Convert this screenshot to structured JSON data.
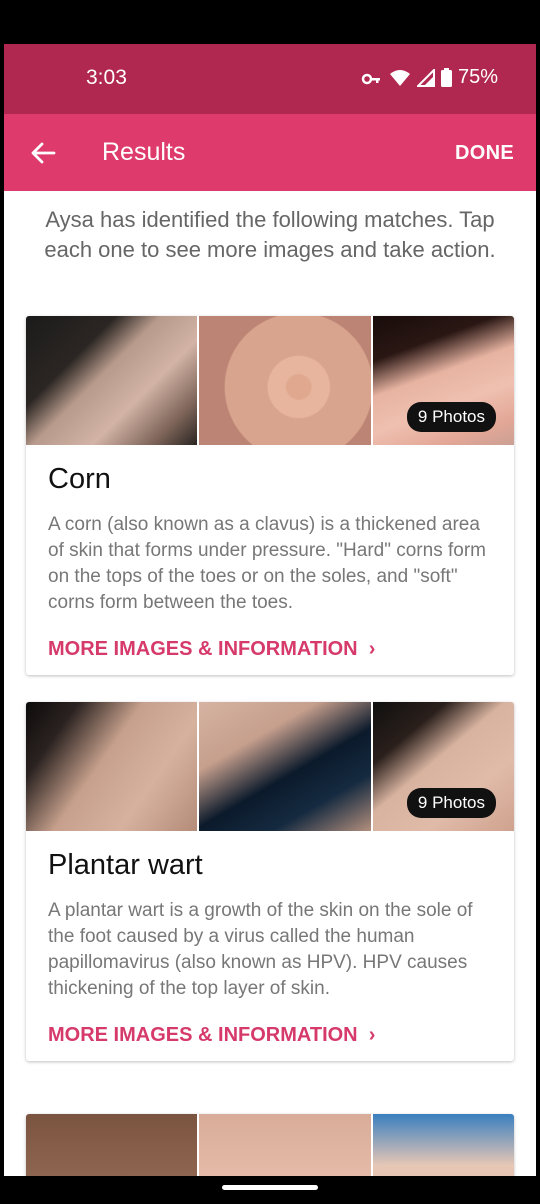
{
  "status_bar": {
    "time": "3:03",
    "battery": "75%",
    "icons": [
      "vpn-key-icon",
      "wifi-icon",
      "signal-icon",
      "battery-icon"
    ]
  },
  "app_bar": {
    "title": "Results",
    "action": "DONE",
    "back_icon": "arrow-left-icon"
  },
  "intro_text": "Aysa has identified the following matches. Tap each one to see more images and take action.",
  "colors": {
    "status_bar": "#b0274f",
    "app_bar": "#de3a6b",
    "link": "#d63a6a"
  },
  "results": [
    {
      "title": "Corn",
      "photos_badge": "9 Photos",
      "description": "A corn (also known as a clavus) is a thickened area of skin that forms under pressure. \"Hard\" corns form on the tops of the toes or on the soles, and \"soft\" corns form between the toes.",
      "link": "MORE IMAGES & INFORMATION"
    },
    {
      "title": "Plantar wart",
      "photos_badge": "9 Photos",
      "description": "A plantar wart is a growth of the skin on the sole of the foot caused by a virus called the human papillomavirus (also known as HPV). HPV causes thickening of the top layer of skin.",
      "link": "MORE IMAGES & INFORMATION"
    }
  ]
}
